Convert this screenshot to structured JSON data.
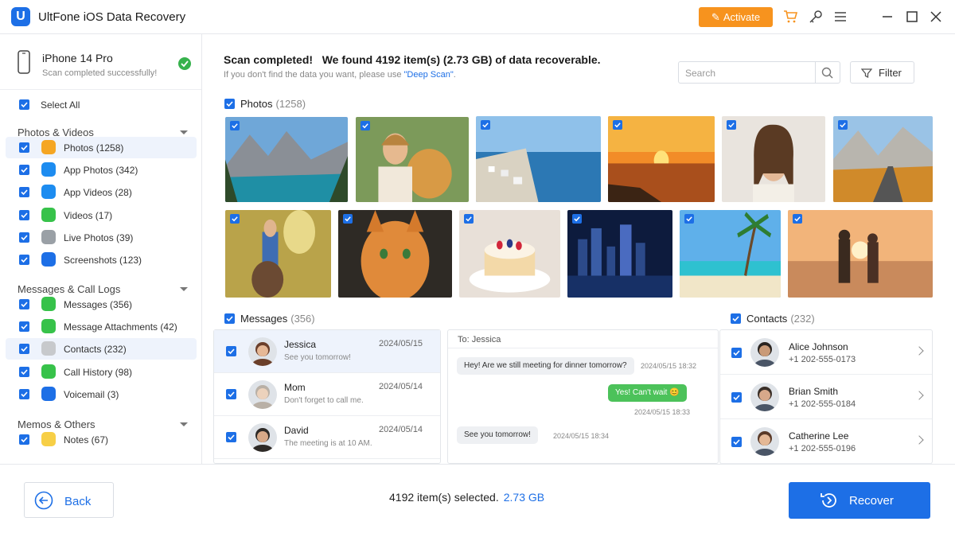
{
  "app": {
    "title": "UltFone iOS Data Recovery",
    "logo_letter": "U",
    "activate_label": "Activate"
  },
  "device": {
    "name": "iPhone 14 Pro",
    "status": "Scan completed successfully!"
  },
  "sidebar": {
    "select_all": "Select All",
    "sections": [
      {
        "title": "Photos & Videos",
        "items": [
          {
            "label": "Photos (1258)",
            "icon": "photos-icon",
            "color": "#f5a623"
          },
          {
            "label": "App Photos (342)",
            "icon": "app-store-icon",
            "color": "#1d8cf0"
          },
          {
            "label": "App Videos (28)",
            "icon": "camera-icon",
            "color": "#1d8cf0"
          },
          {
            "label": "Videos (17)",
            "icon": "video-icon",
            "color": "#37c24a"
          },
          {
            "label": "Live Photos (39)",
            "icon": "live-photo-icon",
            "color": "#9aa0a6"
          },
          {
            "label": "Screenshots (123)",
            "icon": "screenshot-icon",
            "color": "#1d6fe6"
          }
        ]
      },
      {
        "title": "Messages & Call Logs",
        "items": [
          {
            "label": "Messages (356)",
            "icon": "messages-icon",
            "color": "#37c24a"
          },
          {
            "label": "Message Attachments (42)",
            "icon": "attachment-icon",
            "color": "#37c24a"
          },
          {
            "label": "Contacts (232)",
            "icon": "contacts-icon",
            "color": "#c7c9cc"
          },
          {
            "label": "Call History (98)",
            "icon": "phone-icon",
            "color": "#37c24a"
          },
          {
            "label": "Voicemail (3)",
            "icon": "voicemail-icon",
            "color": "#1d6fe6"
          }
        ]
      },
      {
        "title": "Memos & Others",
        "items": [
          {
            "label": "Notes (67)",
            "icon": "notes-icon",
            "color": "#f7cf46"
          }
        ]
      }
    ]
  },
  "scan": {
    "title": "Scan completed!   We found 4192 item(s) (2.73 GB) of data recoverable.",
    "subtitle_prefix": "If you don't find the data you want, please use ",
    "subtitle_link": "\"Deep Scan\"",
    "subtitle_suffix": "."
  },
  "search": {
    "placeholder": "Search"
  },
  "filter_label": "Filter",
  "photos": {
    "label": "Photos",
    "count": "(1258)"
  },
  "messages": {
    "label": "Messages",
    "count": "(356)",
    "items": [
      {
        "name": "Jessica",
        "preview": "See you tomorrow!",
        "date": "2024/05/15"
      },
      {
        "name": "Mom",
        "preview": "Don't forget to call me.",
        "date": "2024/05/14"
      },
      {
        "name": "David",
        "preview": "The meeting is at 10 AM.",
        "date": "2024/05/14"
      }
    ],
    "thread": {
      "to": "To: Jessica",
      "bubbles": [
        {
          "text": "Hey! Are we still meeting for dinner tomorrow?",
          "time": "2024/05/15 18:32",
          "dir": "in"
        },
        {
          "text": "Yes! Can't wait 😊",
          "time": "2024/05/15 18:33",
          "dir": "out"
        },
        {
          "text": "See you tomorrow!",
          "time": "2024/05/15 18:34",
          "dir": "in"
        }
      ]
    }
  },
  "contacts": {
    "label": "Contacts",
    "count": "(232)",
    "items": [
      {
        "name": "Alice Johnson",
        "phone": "+1 202-555-0173"
      },
      {
        "name": "Brian Smith",
        "phone": "+1 202-555-0184"
      },
      {
        "name": "Catherine Lee",
        "phone": "+1 202-555-0196"
      }
    ]
  },
  "footer": {
    "back_label": "Back",
    "selected_text": "4192 item(s) selected.",
    "selected_size": "2.73 GB",
    "recover_label": "Recover"
  },
  "colors": {
    "accent": "#1d6fe6",
    "activate": "#f7931e",
    "success": "#37b24d"
  }
}
